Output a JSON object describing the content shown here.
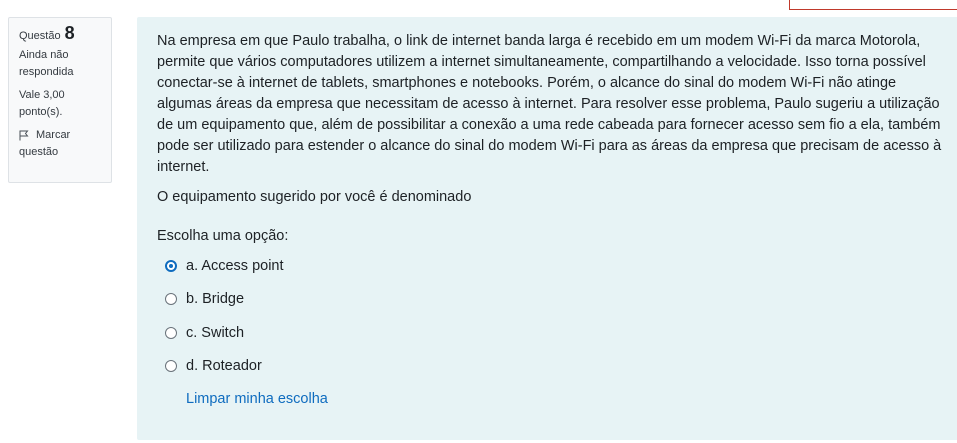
{
  "info": {
    "question_word": "Questão",
    "question_number": "8",
    "state": "Ainda não respondida",
    "grade": "Vale 3,00 ponto(s).",
    "flag_label_1": "Marcar",
    "flag_label_2": "questão"
  },
  "question": {
    "text": "Na empresa em que  Paulo trabalha, o link de internet banda larga é recebido em um modem Wi-Fi da marca Motorola,   permite  que vários computadores utilizem a internet simultaneamente, compartilhando a velocidade. Isso torna possível conectar-se à internet de tablets, smartphones e notebooks. Porém, o alcance do sinal do modem Wi-Fi não atinge algumas áreas da empresa que necessitam de acesso à internet. Para resolver esse problema, Paulo sugeriu a utilização de um equipamento que, além de possibilitar a conexão  a uma rede cabeada para fornecer acesso sem fio a ela, também pode ser utilizado para estender o alcance do sinal do modem Wi-Fi para as áreas da empresa que precisam de acesso à internet.",
    "prompt": "O equipamento sugerido por você é denominado",
    "choose_label": "Escolha uma opção:",
    "options": [
      {
        "label": "a. Access point",
        "selected": true
      },
      {
        "label": "b. Bridge",
        "selected": false
      },
      {
        "label": "c. Switch",
        "selected": false
      },
      {
        "label": "d. Roteador",
        "selected": false
      }
    ],
    "clear_label": "Limpar minha escolha"
  },
  "colors": {
    "accent": "#0f6cbf",
    "content_bg": "#e7f3f5",
    "info_bg": "#f8f9fa"
  }
}
